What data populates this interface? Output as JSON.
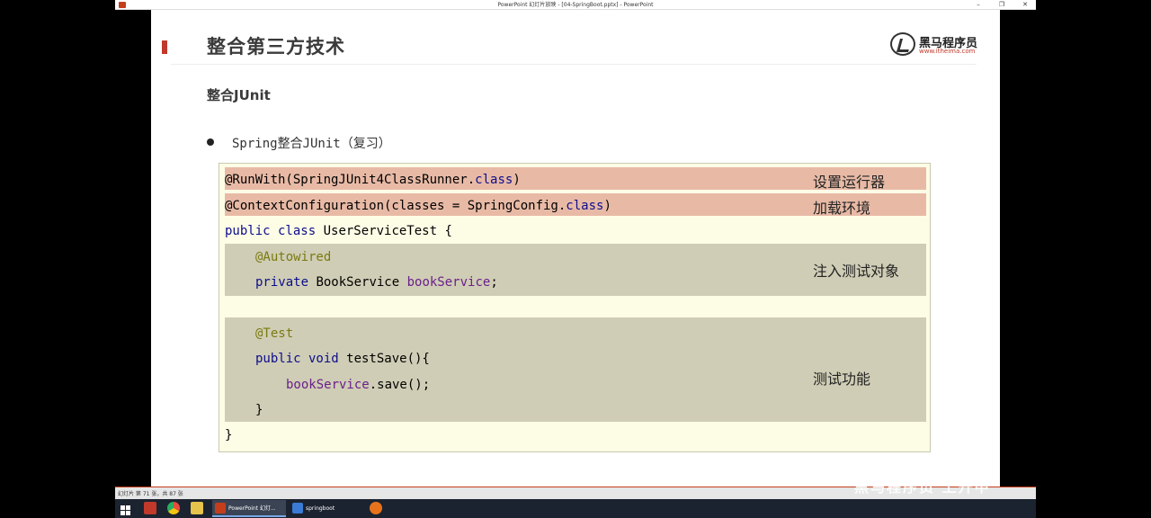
{
  "window": {
    "title": "PowerPoint 幻灯片放映 - [04-SpringBoot.pptx] - PowerPoint",
    "controls": [
      "–",
      "❐",
      "✕"
    ]
  },
  "slide": {
    "title": "整合第三方技术",
    "logo": {
      "name": "黑马程序员",
      "url": "www.itheima.com"
    },
    "section": "整合JUnit",
    "bullet": "Spring整合JUnit（复习）",
    "code": {
      "line1": {
        "a": "@RunWith(SpringJUnit4ClassRunner.",
        "b": "class",
        "c": ")"
      },
      "line2": {
        "a": "@ContextConfiguration(classes = SpringConfig.",
        "b": "class",
        "c": ")"
      },
      "line3": {
        "a": "public class",
        "b": " UserServiceTest {"
      },
      "line4": "@Autowired",
      "line5": {
        "a": "private",
        "b": " BookService ",
        "c": "bookService",
        "d": ";"
      },
      "line6": "@Test",
      "line7": {
        "a": "public void",
        "b": " testSave(){"
      },
      "line8": {
        "a": "bookService",
        "b": ".save();"
      },
      "line9": "}",
      "line10": "}"
    },
    "notes": {
      "runner": "设置运行器",
      "config": "加载环境",
      "inject": "注入测试对象",
      "test": "测试功能"
    }
  },
  "statusbar": {
    "text": "幻灯片 第 71 张，共 87 张"
  },
  "watermark": "黑马程序员 上升中",
  "taskbar": {
    "tasks": [
      {
        "label": "PowerPoint 幻灯...",
        "color": "#c43e1c"
      },
      {
        "label": "springboot",
        "color": "#3a7bd5"
      }
    ],
    "colors": {
      "chrome": "#e8a020",
      "chrome2": "#3a9a3a",
      "explorer": "#e6c34a",
      "start": "#ffffff"
    }
  }
}
